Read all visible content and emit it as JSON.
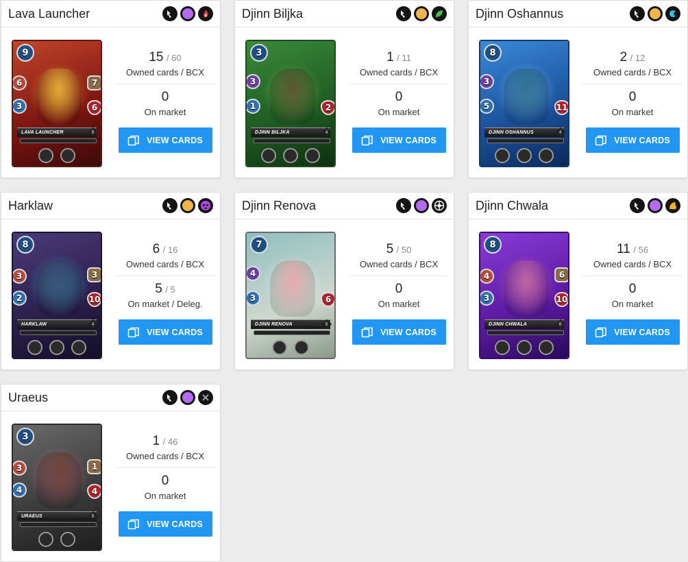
{
  "cards": [
    {
      "name": "Lava Launcher",
      "card_label": "LAVA LAUNCHER",
      "mana": "9",
      "attack": "6",
      "speed": "3",
      "armor": "7",
      "health": "6",
      "level": "6",
      "badge_icons": [
        "monster-type-icon",
        "purple-rarity-icon",
        "fire-element-icon"
      ],
      "ability_icons": [
        "ability-icon",
        "ability-icon"
      ],
      "owned": "15",
      "owned_total": "/ 60",
      "owned_caption": "Owned cards / BCX",
      "market": "0",
      "market_total": "",
      "market_caption": "On market",
      "button": "VIEW CARDS",
      "theme": "fire"
    },
    {
      "name": "Djinn Biljka",
      "card_label": "DJINN BILJKA",
      "mana": "3",
      "attack": "3",
      "speed": "1",
      "armor": "",
      "health": "2",
      "level": "4",
      "badge_icons": [
        "monster-type-icon",
        "gold-rarity-icon",
        "earth-element-icon"
      ],
      "ability_icons": [
        "ability-icon",
        "ability-icon",
        "ability-icon"
      ],
      "owned": "1",
      "owned_total": "/ 11",
      "owned_caption": "Owned cards / BCX",
      "market": "0",
      "market_total": "",
      "market_caption": "On market",
      "button": "VIEW CARDS",
      "theme": "earth"
    },
    {
      "name": "Djinn Oshannus",
      "card_label": "DJINN OSHANNUS",
      "mana": "8",
      "attack": "3",
      "speed": "5",
      "armor": "",
      "health": "11",
      "level": "4",
      "badge_icons": [
        "monster-type-icon",
        "gold-rarity-icon",
        "water-element-icon"
      ],
      "ability_icons": [
        "ability-icon",
        "ability-icon",
        "ability-icon"
      ],
      "owned": "2",
      "owned_total": "/ 12",
      "owned_caption": "Owned cards / BCX",
      "market": "0",
      "market_total": "",
      "market_caption": "On market",
      "button": "VIEW CARDS",
      "theme": "water"
    },
    {
      "name": "Harklaw",
      "card_label": "HARKLAW",
      "mana": "8",
      "attack": "3",
      "speed": "2",
      "armor": "3",
      "health": "10",
      "level": "4",
      "badge_icons": [
        "monster-type-icon",
        "gold-rarity-icon",
        "death-element-icon"
      ],
      "ability_icons": [
        "ability-icon",
        "ability-icon",
        "ability-icon"
      ],
      "owned": "6",
      "owned_total": "/ 16",
      "owned_caption": "Owned cards / BCX",
      "market": "5",
      "market_total": "/ 5",
      "market_caption": "On market / Deleg.",
      "button": "VIEW CARDS",
      "theme": "death"
    },
    {
      "name": "Djinn Renova",
      "card_label": "DJINN RENOVA",
      "mana": "7",
      "attack": "4",
      "speed": "3",
      "armor": "",
      "health": "6",
      "level": "6",
      "badge_icons": [
        "monster-type-icon",
        "purple-rarity-icon",
        "life-element-icon"
      ],
      "ability_icons": [
        "ability-icon",
        "ability-icon"
      ],
      "owned": "5",
      "owned_total": "/ 50",
      "owned_caption": "Owned cards / BCX",
      "market": "0",
      "market_total": "",
      "market_caption": "On market",
      "button": "VIEW CARDS",
      "theme": "life"
    },
    {
      "name": "Djinn Chwala",
      "card_label": "DJINN CHWALA",
      "mana": "8",
      "attack": "4",
      "speed": "3",
      "armor": "6",
      "health": "10",
      "level": "6",
      "badge_icons": [
        "monster-type-icon",
        "purple-rarity-icon",
        "dragon-element-icon"
      ],
      "ability_icons": [
        "ability-icon",
        "ability-icon",
        "ability-icon"
      ],
      "owned": "11",
      "owned_total": "/ 56",
      "owned_caption": "Owned cards / BCX",
      "market": "0",
      "market_total": "",
      "market_caption": "On market",
      "button": "VIEW CARDS",
      "theme": "dragon"
    },
    {
      "name": "Uraeus",
      "card_label": "URAEUS",
      "mana": "3",
      "attack": "3",
      "speed": "4",
      "armor": "1",
      "health": "4",
      "level": "6",
      "badge_icons": [
        "monster-type-icon",
        "purple-rarity-icon",
        "neutral-element-icon"
      ],
      "ability_icons": [
        "ability-icon",
        "ability-icon"
      ],
      "owned": "1",
      "owned_total": "/ 46",
      "owned_caption": "Owned cards / BCX",
      "market": "0",
      "market_total": "",
      "market_caption": "On market",
      "button": "VIEW CARDS",
      "theme": "neutral"
    }
  ],
  "colors": {
    "button": "#2196f3",
    "background": "#ececec",
    "panel": "#ffffff"
  }
}
